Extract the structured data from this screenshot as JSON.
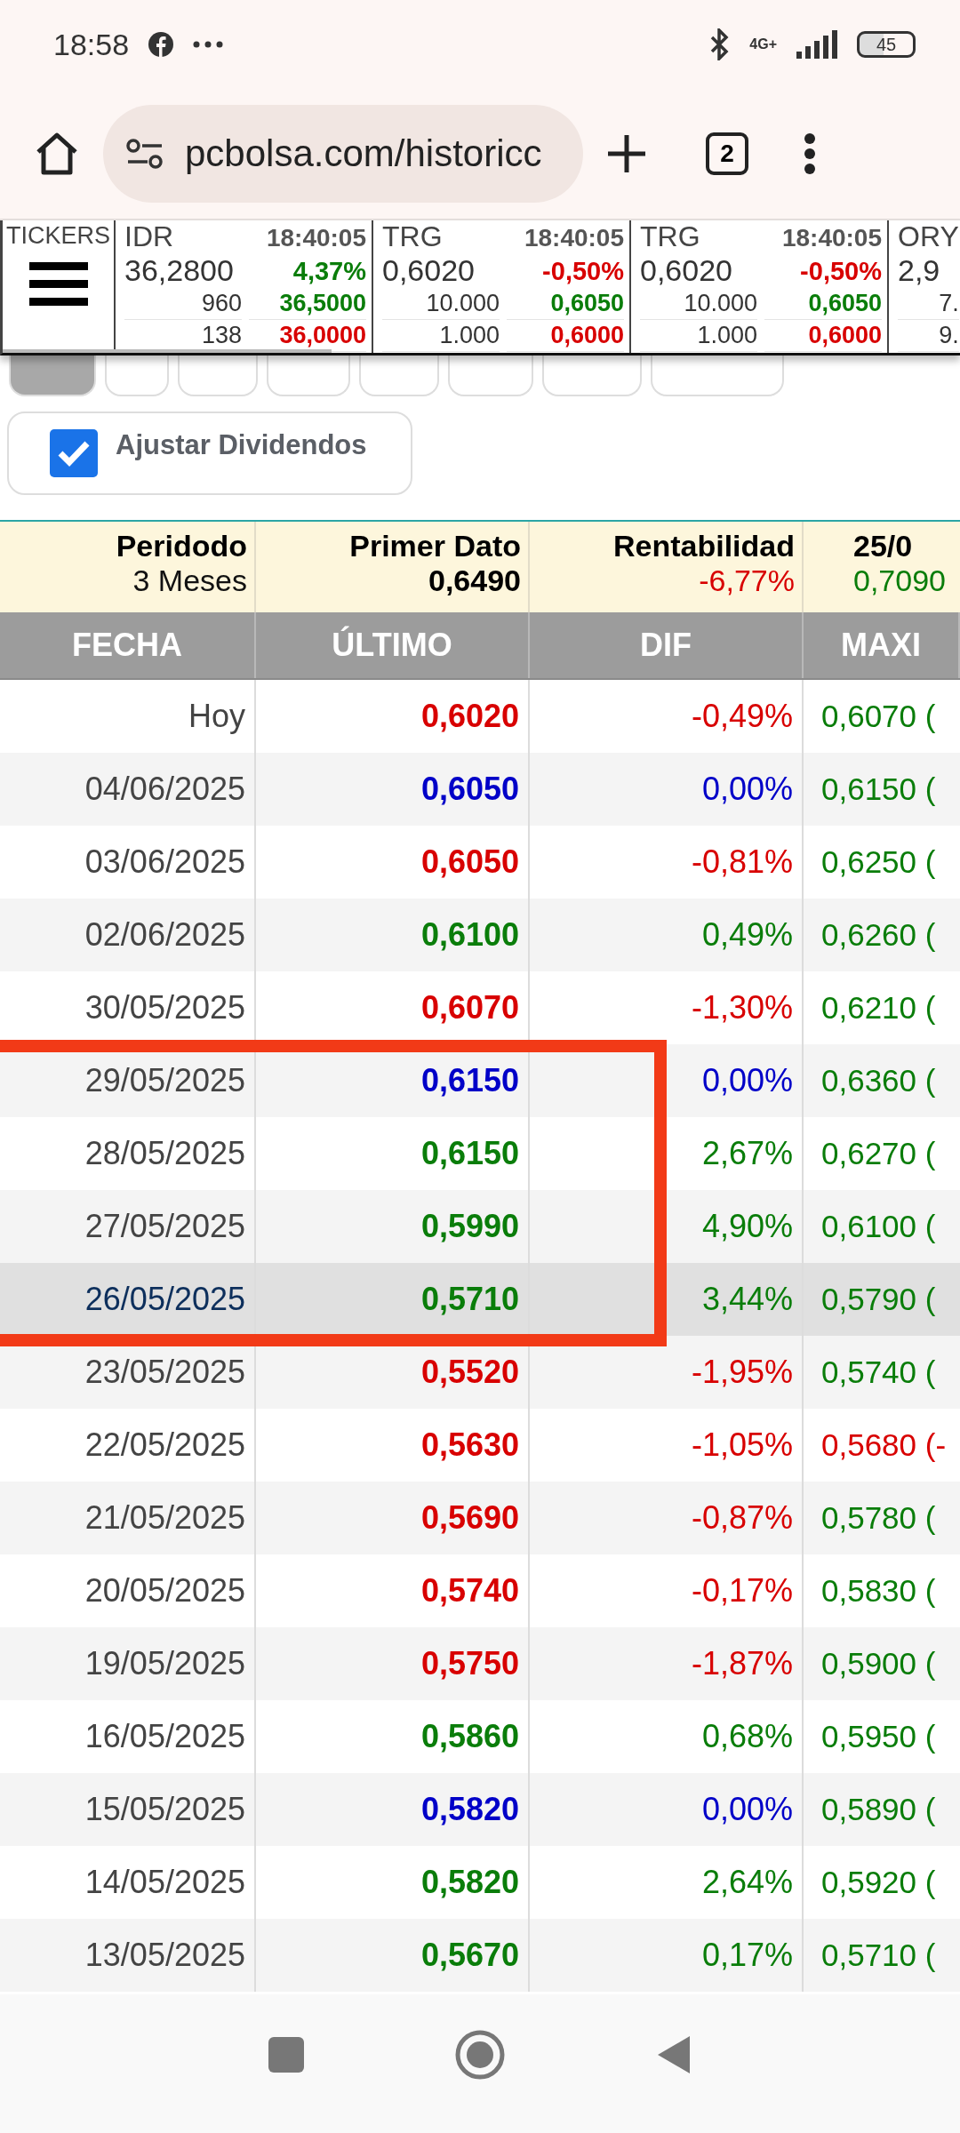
{
  "status_bar": {
    "time": "18:58",
    "network": "4G+",
    "battery": "45"
  },
  "browser": {
    "url": "pcbolsa.com/historicc",
    "tab_count": "2"
  },
  "tickers": {
    "label": "TICKERS",
    "items": [
      {
        "symbol": "IDR",
        "time": "18:40:05",
        "price": "36,2800",
        "change": {
          "text": "4,37%",
          "color": "#0a7d0a"
        },
        "bid_volume": "960",
        "bid": "36,5000",
        "ask_volume": "138",
        "ask": "36,0000"
      },
      {
        "symbol": "TRG",
        "time": "18:40:05",
        "price": "0,6020",
        "change": {
          "text": "-0,50%",
          "color": "#d80000"
        },
        "bid_volume": "10.000",
        "bid": "0,6050",
        "ask_volume": "1.000",
        "ask": "0,6000"
      },
      {
        "symbol": "TRG",
        "time": "18:40:05",
        "price": "0,6020",
        "change": {
          "text": "-0,50%",
          "color": "#d80000"
        },
        "bid_volume": "10.000",
        "bid": "0,6050",
        "ask_volume": "1.000",
        "ask": "0,6000"
      },
      {
        "symbol": "ORY",
        "price": "2,9",
        "bid_volume": "7.",
        "ask_volume": "9."
      }
    ]
  },
  "period_buttons": [
    {
      "selected": true
    },
    {
      "selected": false
    },
    {
      "selected": false
    },
    {
      "selected": false
    },
    {
      "selected": false
    },
    {
      "selected": false
    },
    {
      "selected": false
    },
    {
      "selected": false
    }
  ],
  "adjust_dividends": {
    "label": "Ajustar Dividendos",
    "checked": true
  },
  "summary": [
    {
      "label": "Peridodo",
      "value": {
        "text": "3 Meses",
        "color": "#111111"
      }
    },
    {
      "label": "Primer Dato",
      "value": {
        "text": "0,6490",
        "color": "#000000"
      }
    },
    {
      "label": "Rentabilidad",
      "value": {
        "text": "-6,77%",
        "color": "#d80000"
      }
    },
    {
      "label": "25/0",
      "value": {
        "text": "0,7090",
        "color": "#0a7d0a"
      }
    }
  ],
  "table": {
    "columns": [
      "FECHA",
      "ÚLTIMO",
      "DIF",
      "MAXI"
    ],
    "rows": [
      {
        "date": "Hoy",
        "last": {
          "text": "0,6020",
          "color": "#d80000"
        },
        "dif": {
          "text": "-0,49%",
          "color": "#d80000"
        },
        "max": {
          "text": "0,6070 (",
          "color": "#0a7d0a"
        },
        "selected": false
      },
      {
        "date": "04/06/2025",
        "last": {
          "text": "0,6050",
          "color": "#0000c8"
        },
        "dif": {
          "text": "0,00%",
          "color": "#0000c8"
        },
        "max": {
          "text": "0,6150 (",
          "color": "#0a7d0a"
        },
        "selected": false
      },
      {
        "date": "03/06/2025",
        "last": {
          "text": "0,6050",
          "color": "#d80000"
        },
        "dif": {
          "text": "-0,81%",
          "color": "#d80000"
        },
        "max": {
          "text": "0,6250 (",
          "color": "#0a7d0a"
        },
        "selected": false
      },
      {
        "date": "02/06/2025",
        "last": {
          "text": "0,6100",
          "color": "#0a7d0a"
        },
        "dif": {
          "text": "0,49%",
          "color": "#0a7d0a"
        },
        "max": {
          "text": "0,6260 (",
          "color": "#0a7d0a"
        },
        "selected": false
      },
      {
        "date": "30/05/2025",
        "last": {
          "text": "0,6070",
          "color": "#d80000"
        },
        "dif": {
          "text": "-1,30%",
          "color": "#d80000"
        },
        "max": {
          "text": "0,6210 (",
          "color": "#0a7d0a"
        },
        "selected": false
      },
      {
        "date": "29/05/2025",
        "last": {
          "text": "0,6150",
          "color": "#0000c8"
        },
        "dif": {
          "text": "0,00%",
          "color": "#0000c8"
        },
        "max": {
          "text": "0,6360 (",
          "color": "#0a7d0a"
        },
        "selected": false
      },
      {
        "date": "28/05/2025",
        "last": {
          "text": "0,6150",
          "color": "#0a7d0a"
        },
        "dif": {
          "text": "2,67%",
          "color": "#0a7d0a"
        },
        "max": {
          "text": "0,6270 (",
          "color": "#0a7d0a"
        },
        "selected": false
      },
      {
        "date": "27/05/2025",
        "last": {
          "text": "0,5990",
          "color": "#0a7d0a"
        },
        "dif": {
          "text": "4,90%",
          "color": "#0a7d0a"
        },
        "max": {
          "text": "0,6100 (",
          "color": "#0a7d0a"
        },
        "selected": false
      },
      {
        "date": "26/05/2025",
        "last": {
          "text": "0,5710",
          "color": "#0a7d0a"
        },
        "dif": {
          "text": "3,44%",
          "color": "#0a7d0a"
        },
        "max": {
          "text": "0,5790 (",
          "color": "#0a7d0a"
        },
        "selected": true
      },
      {
        "date": "23/05/2025",
        "last": {
          "text": "0,5520",
          "color": "#d80000"
        },
        "dif": {
          "text": "-1,95%",
          "color": "#d80000"
        },
        "max": {
          "text": "0,5740 (",
          "color": "#0a7d0a"
        },
        "selected": false
      },
      {
        "date": "22/05/2025",
        "last": {
          "text": "0,5630",
          "color": "#d80000"
        },
        "dif": {
          "text": "-1,05%",
          "color": "#d80000"
        },
        "max": {
          "text": "0,5680 (-",
          "color": "#d80000"
        },
        "selected": false
      },
      {
        "date": "21/05/2025",
        "last": {
          "text": "0,5690",
          "color": "#d80000"
        },
        "dif": {
          "text": "-0,87%",
          "color": "#d80000"
        },
        "max": {
          "text": "0,5780 (",
          "color": "#0a7d0a"
        },
        "selected": false
      },
      {
        "date": "20/05/2025",
        "last": {
          "text": "0,5740",
          "color": "#d80000"
        },
        "dif": {
          "text": "-0,17%",
          "color": "#d80000"
        },
        "max": {
          "text": "0,5830 (",
          "color": "#0a7d0a"
        },
        "selected": false
      },
      {
        "date": "19/05/2025",
        "last": {
          "text": "0,5750",
          "color": "#d80000"
        },
        "dif": {
          "text": "-1,87%",
          "color": "#d80000"
        },
        "max": {
          "text": "0,5900 (",
          "color": "#0a7d0a"
        },
        "selected": false
      },
      {
        "date": "16/05/2025",
        "last": {
          "text": "0,5860",
          "color": "#0a7d0a"
        },
        "dif": {
          "text": "0,68%",
          "color": "#0a7d0a"
        },
        "max": {
          "text": "0,5950 (",
          "color": "#0a7d0a"
        },
        "selected": false
      },
      {
        "date": "15/05/2025",
        "last": {
          "text": "0,5820",
          "color": "#0000c8"
        },
        "dif": {
          "text": "0,00%",
          "color": "#0000c8"
        },
        "max": {
          "text": "0,5890 (",
          "color": "#0a7d0a"
        },
        "selected": false
      },
      {
        "date": "14/05/2025",
        "last": {
          "text": "0,5820",
          "color": "#0a7d0a"
        },
        "dif": {
          "text": "2,64%",
          "color": "#0a7d0a"
        },
        "max": {
          "text": "0,5920 (",
          "color": "#0a7d0a"
        },
        "selected": false
      },
      {
        "date": "13/05/2025",
        "last": {
          "text": "0,5670",
          "color": "#0a7d0a"
        },
        "dif": {
          "text": "0,17%",
          "color": "#0a7d0a"
        },
        "max": {
          "text": "0,5710 (",
          "color": "#0a7d0a"
        },
        "selected": false
      }
    ]
  }
}
